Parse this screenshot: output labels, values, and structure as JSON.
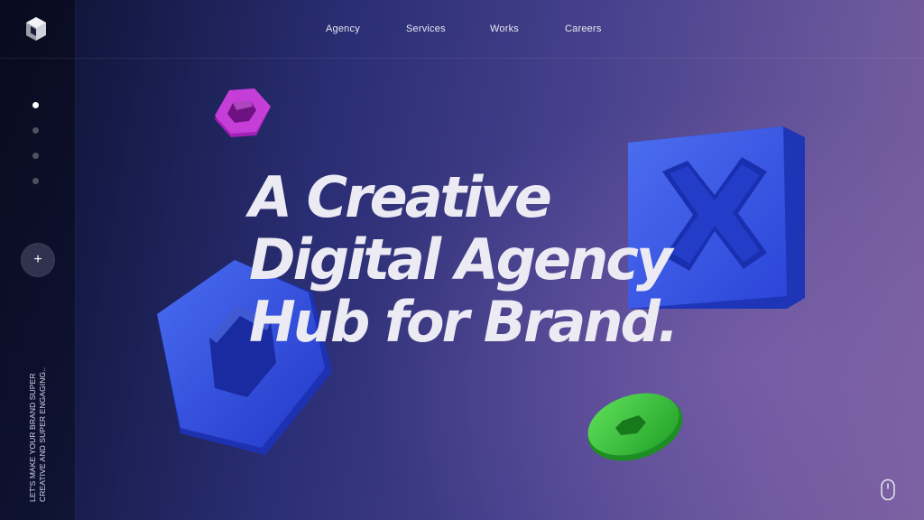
{
  "nav": {
    "items": [
      "Agency",
      "Services",
      "Works",
      "Careers"
    ]
  },
  "sidebar": {
    "dots_count": 4,
    "active_dot": 0,
    "plus_label": "+",
    "tagline_line1": "LET'S MAKE YOUR BRAND SUPER",
    "tagline_line2": "CREATIVE AND SUPER ENGAGING.."
  },
  "hero": {
    "line1": "A Creative",
    "line2": "Digital Agency",
    "line3": "Hub for Brand."
  },
  "icons": {
    "logo": "cube-logo-icon",
    "scroll": "mouse-scroll-icon",
    "shapes": [
      "magenta-hexagon-ring",
      "blue-x-block",
      "blue-hexagon-ring",
      "green-ring"
    ]
  },
  "colors": {
    "accent_blue": "#2f4fe0",
    "magenta": "#c23bd4",
    "green": "#3ec43a",
    "text": "#eceaf3"
  }
}
